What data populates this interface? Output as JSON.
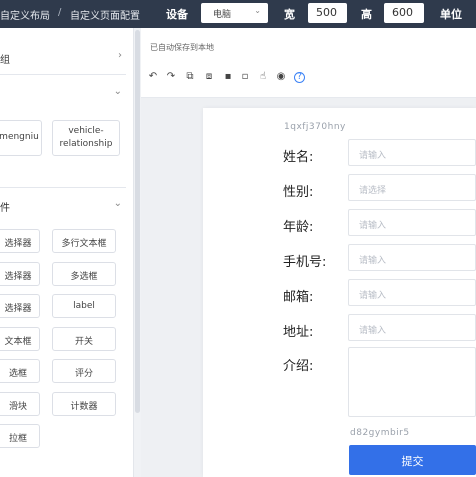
{
  "header": {
    "breadcrumb_1": "自定义布局",
    "breadcrumb_sep": "/",
    "breadcrumb_2": "自定义页面配置",
    "device_label": "设备",
    "device_value": "电脑",
    "width_label": "宽",
    "width_value": "500",
    "height_label": "高",
    "height_value": "600",
    "unit_label": "单位"
  },
  "sidebar": {
    "section_1_title": "组",
    "section_2_title": "",
    "section_3_title": "件",
    "relation_items": [
      "mengniu",
      "vehicle-relationship"
    ],
    "components": [
      [
        "选择器",
        "多行文本框"
      ],
      [
        "选择器",
        "多选框"
      ],
      [
        "选择器",
        "label"
      ],
      [
        "文本框",
        "开关"
      ],
      [
        "选框",
        "评分"
      ],
      [
        "滑块",
        "计数器"
      ],
      [
        "拉框",
        ""
      ]
    ]
  },
  "toolbar": {
    "saved_text": "已自动保存到本地",
    "icons": [
      "undo-icon",
      "redo-icon",
      "copy-icon",
      "paste-icon",
      "lock-icon",
      "unlock-icon",
      "thumb-icon",
      "eye-icon",
      "help-icon"
    ]
  },
  "form": {
    "id_top": "1qxfj370hny",
    "id_bottom": "d82gymbir5",
    "fields": [
      {
        "label": "姓名:",
        "placeholder": "请输入"
      },
      {
        "label": "性别:",
        "placeholder": "请选择"
      },
      {
        "label": "年龄:",
        "placeholder": "请输入"
      },
      {
        "label": "手机号:",
        "placeholder": "请输入"
      },
      {
        "label": "邮箱:",
        "placeholder": "请输入"
      },
      {
        "label": "地址:",
        "placeholder": "请输入"
      }
    ],
    "intro_label": "介绍:",
    "submit_label": "提交"
  },
  "colors": {
    "topbar": "#2f3a4c",
    "primary": "#3370e8"
  }
}
